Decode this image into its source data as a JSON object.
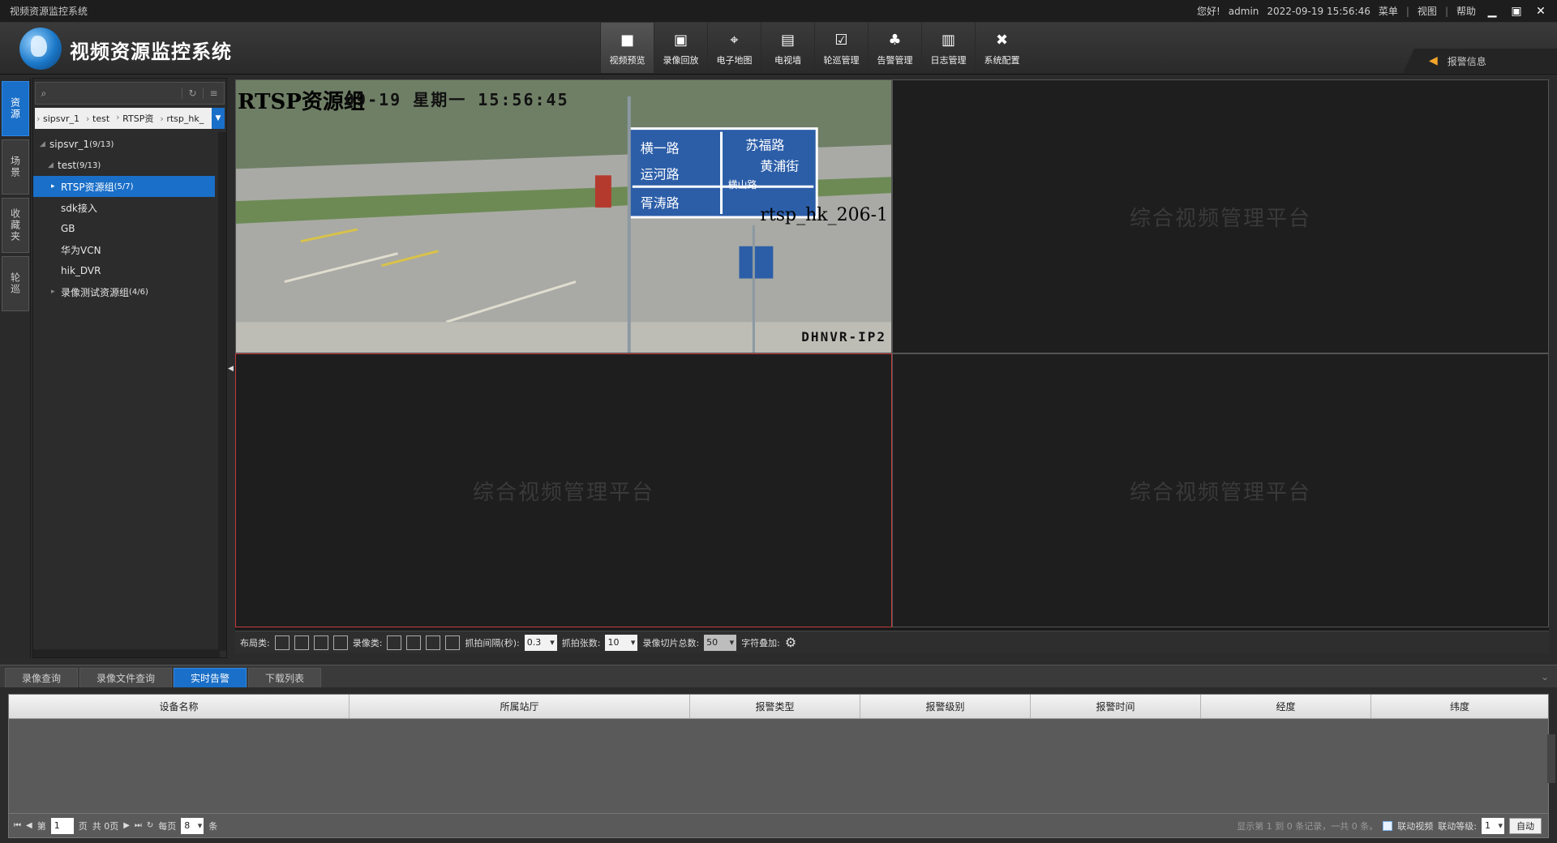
{
  "window": {
    "title": "视频资源监控系统"
  },
  "topbar": {
    "greeting": "您好!",
    "user": "admin",
    "datetime": "2022-09-19 15:56:46",
    "menu_items": [
      "菜单",
      "视图",
      "帮助"
    ],
    "controls": [
      "minimize-icon",
      "maximize-icon",
      "close-icon"
    ]
  },
  "header": {
    "title": "视频资源监控系统",
    "nav": [
      {
        "label": "视频预览",
        "icon": "camera-icon",
        "active": true
      },
      {
        "label": "录像回放",
        "icon": "playback-icon",
        "active": false
      },
      {
        "label": "电子地图",
        "icon": "map-pin-icon",
        "active": false
      },
      {
        "label": "电视墙",
        "icon": "tv-wall-icon",
        "active": false
      },
      {
        "label": "轮巡管理",
        "icon": "check-icon",
        "active": false
      },
      {
        "label": "告警管理",
        "icon": "bell-icon",
        "active": false
      },
      {
        "label": "日志管理",
        "icon": "log-icon",
        "active": false
      },
      {
        "label": "系统配置",
        "icon": "tools-icon",
        "active": false
      }
    ],
    "alarm_info": "报警信息"
  },
  "sidebar_tabs": [
    {
      "label": "资源",
      "active": true
    },
    {
      "label": "场景",
      "active": false
    },
    {
      "label": "收藏夹",
      "active": false
    },
    {
      "label": "轮巡",
      "active": false
    }
  ],
  "tree": {
    "search_value": "",
    "breadcrumbs": [
      "sipsvr_1",
      "test",
      "RTSP资",
      "rtsp_hk_"
    ],
    "nodes": [
      {
        "label": "sipsvr_1",
        "count": "(9/13)",
        "level": 0,
        "expanded": true
      },
      {
        "label": "test",
        "count": "(9/13)",
        "level": 1,
        "expanded": true
      },
      {
        "label": "RTSP资源组",
        "count": "(5/7)",
        "level": 2,
        "selected": true
      },
      {
        "label": "sdk接入",
        "count": "",
        "level": 2
      },
      {
        "label": "GB",
        "count": "",
        "level": 2
      },
      {
        "label": "华为VCN",
        "count": "",
        "level": 2
      },
      {
        "label": "hik_DVR",
        "count": "",
        "level": 2
      },
      {
        "label": "录像测试资源组",
        "count": "(4/6)",
        "level": 2
      }
    ]
  },
  "video": {
    "placeholder": "综合视频管理平台",
    "cam": {
      "group_label": "RTSP资源组",
      "timestamp": "09-19 星期一 15:56:45",
      "name": "rtsp_hk_206-1",
      "watermark": "DHNVR-IP2",
      "signs": [
        "横一路",
        "苏福路",
        "运河路",
        "黄浦街",
        "横山路",
        "胥涛路"
      ]
    }
  },
  "video_toolbar": {
    "layout_label": "布局类:",
    "record_label": "录像类:",
    "snap_interval_label": "抓拍间隔(秒):",
    "snap_interval": "0.3",
    "snap_count_label": "抓拍张数:",
    "snap_count": "10",
    "slice_total_label": "录像切片总数:",
    "slice_total": "50",
    "overlay_label": "字符叠加:"
  },
  "bottom": {
    "tabs": [
      {
        "label": "录像查询",
        "active": false
      },
      {
        "label": "录像文件查询",
        "active": false
      },
      {
        "label": "实时告警",
        "active": true
      },
      {
        "label": "下载列表",
        "active": false
      }
    ],
    "columns": [
      "设备名称",
      "所属站厅",
      "报警类型",
      "报警级别",
      "报警时间",
      "经度",
      "纬度"
    ],
    "pager": {
      "page_prefix": "第",
      "page": "1",
      "page_suffix": "页",
      "total_pages": "共 0页",
      "per_page_label": "每页",
      "per_page": "8",
      "per_page_unit": "条",
      "summary": "显示第 1 到 0 条记录，一共 0 条。",
      "link_video_label": "联动视频",
      "link_level_label": "联动等级:",
      "link_level": "1",
      "auto_label": "自动"
    }
  }
}
